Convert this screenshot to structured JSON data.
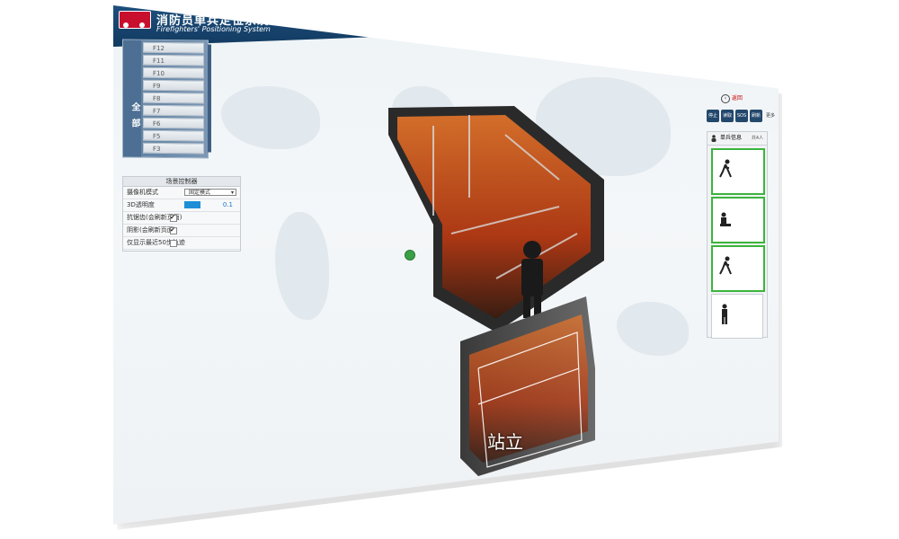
{
  "app": {
    "title_cn": "消防员单兵定位系统",
    "title_en": "Firefighters' Positioning System"
  },
  "floors": {
    "all_label": "全部",
    "items": [
      "F12",
      "F11",
      "F10",
      "F9",
      "F8",
      "F7",
      "F6",
      "F5",
      "F3"
    ]
  },
  "controller": {
    "title": "场景控制器",
    "camera_mode_label": "摄像机模式",
    "camera_mode_value": "固定模式",
    "opacity_label": "3D透明度",
    "opacity_value": "0.1",
    "antialias_label": "抗锯齿(会刷新页面)",
    "antialias_checked": true,
    "shadow_label": "阴影(会刷新页面)",
    "shadow_checked": true,
    "track_label": "仅显示最近50步轨迹",
    "track_checked": false
  },
  "scene": {
    "status_label": "站立"
  },
  "right": {
    "return_label": "返回",
    "toolbar": [
      "停止",
      "读取",
      "SOS",
      "刷新",
      "更多"
    ],
    "panel_title": "单兵信息",
    "panel_count": "共4人"
  },
  "colors": {
    "header": "#1d4f7d",
    "accent": "#1e8fd6",
    "active_border": "#3cb43c",
    "fire": "#e85a1a"
  }
}
